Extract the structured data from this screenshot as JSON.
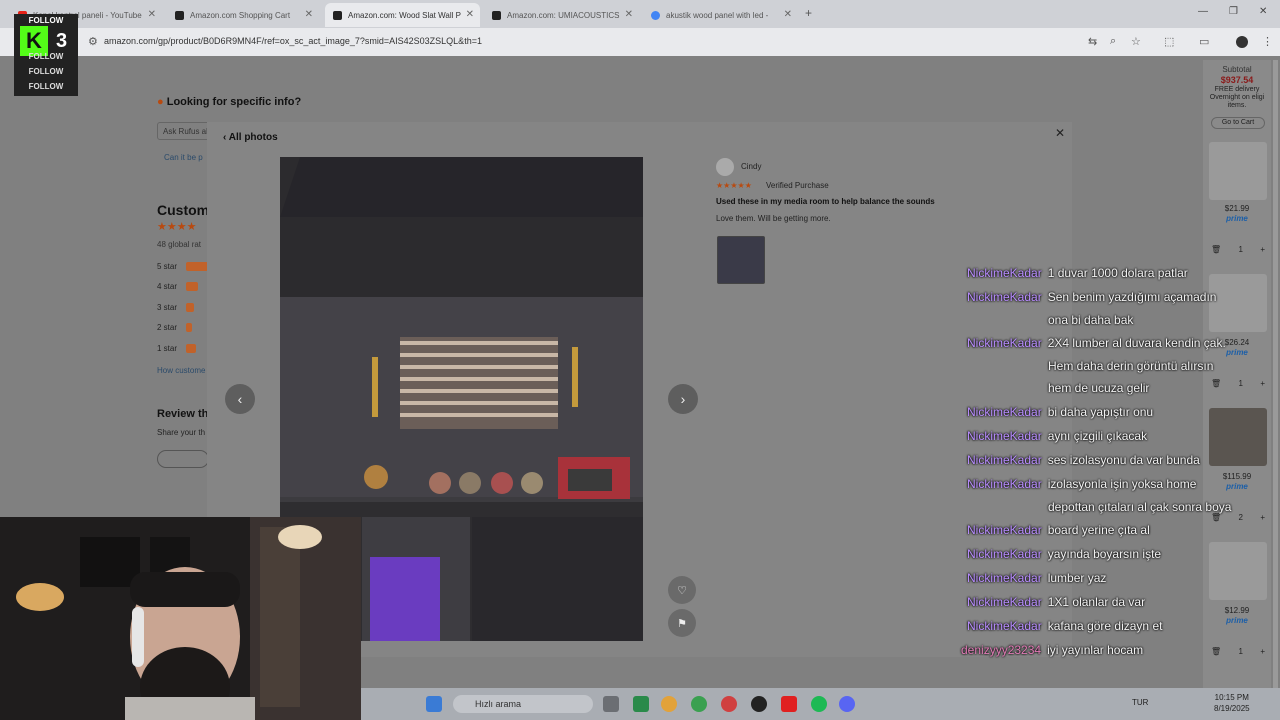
{
  "browser": {
    "tabs": [
      {
        "title": "Kanal kontrol paneli - YouTube",
        "fav_color": "#e62117"
      },
      {
        "title": "Amazon.com Shopping Cart",
        "fav_color": "#222222"
      },
      {
        "title": "Amazon.com: Wood Slat Wall P",
        "fav_color": "#222222"
      },
      {
        "title": "Amazon.com: UMIACOUSTICS",
        "fav_color": "#222222"
      },
      {
        "title": "akustik wood panel with led -",
        "fav_color": "#4285f4"
      }
    ],
    "url": "amazon.com/gp/product/B0D6R9MN4F/ref=ox_sc_act_image_7?smid=AIS42S03ZSLQL&th=1"
  },
  "page": {
    "looking_for": "Looking for specific info?",
    "search_placeholder": "Ask Rufus ab",
    "can_it": "Can it be p",
    "customer_heading": "Custom",
    "global_ratings": "48 global rat",
    "star_rows": [
      "5 star",
      "4 star",
      "3 star",
      "2 star",
      "1 star"
    ],
    "how_customer": "How custome",
    "review_heading": "Review th",
    "share_text": "Share your th"
  },
  "cart": {
    "subtotal_label": "Subtotal",
    "subtotal": "$937.54",
    "delivery": "FREE delivery Overnight on eligi items.",
    "go_to_cart": "Go to Cart",
    "items": [
      {
        "price": "$21.99",
        "qty": "1"
      },
      {
        "price": "$26.24",
        "qty": "1"
      },
      {
        "price": "$115.99",
        "qty": "2"
      },
      {
        "price": "$12.99",
        "qty": "1"
      }
    ],
    "prime": "prime"
  },
  "modal": {
    "all_photos": "All photos",
    "reviewer": "Cindy",
    "stars": "★★★★★",
    "verified": "Verified Purchase",
    "review_title": "Used these in my media room to help balance the sounds",
    "review_body": "Love them. Will be getting more."
  },
  "chat": [
    {
      "user": "NickimeKadar",
      "msg": "1 duvar 1000 dolara patlar"
    },
    {
      "user": "NickimeKadar",
      "msg": "Sen benim yazdığımı açamadın"
    },
    {
      "user": "",
      "msg": "ona bi daha bak"
    },
    {
      "user": "NickimeKadar",
      "msg": "2X4 lumber al duvara kendin çak."
    },
    {
      "user": "",
      "msg": "Hem daha derin görüntü alırsın"
    },
    {
      "user": "",
      "msg": "hem de ucuza gelir"
    },
    {
      "user": "NickimeKadar",
      "msg": "bi daha yapıştır onu"
    },
    {
      "user": "NickimeKadar",
      "msg": "aynı çizgili çıkacak"
    },
    {
      "user": "NickimeKadar",
      "msg": "ses izolasyonu da var bunda"
    },
    {
      "user": "NickimeKadar",
      "msg": "izolasyonla işin yoksa home"
    },
    {
      "user": "",
      "msg": "depottan çıtaları al çak sonra boya"
    },
    {
      "user": "NickimeKadar",
      "msg": "board yerine çıta al"
    },
    {
      "user": "NickimeKadar",
      "msg": "yayında boyarsın işte"
    },
    {
      "user": "NickimeKadar",
      "msg": "lumber yaz"
    },
    {
      "user": "NickimeKadar",
      "msg": "1X1 olanlar da var"
    },
    {
      "user": "NickimeKadar",
      "msg": "kafana göre dizayn et"
    },
    {
      "user": "denizyyy23234",
      "msg": "iyi yayınlar hocam"
    }
  ],
  "overlay": {
    "follow_labels": [
      "FOLLOW",
      "FOLLOW",
      "FOLLOW",
      "FOLLOW",
      "FOLLOW"
    ],
    "kick_letter": "K",
    "kick_count": "3"
  },
  "taskbar": {
    "search_placeholder": "Hızlı arama",
    "lang": "TUR",
    "time": "10:15 PM",
    "date": "8/19/2025"
  }
}
